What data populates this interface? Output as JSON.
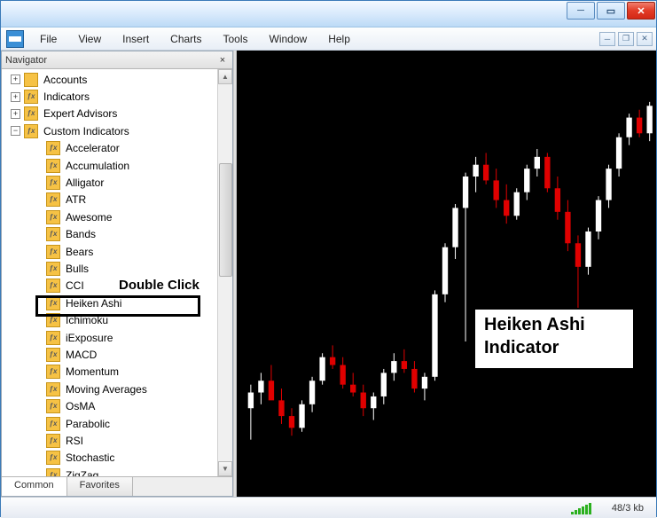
{
  "menu": {
    "items": [
      "File",
      "View",
      "Insert",
      "Charts",
      "Tools",
      "Window",
      "Help"
    ]
  },
  "navigator": {
    "title": "Navigator",
    "close_glyph": "×",
    "top": [
      {
        "label": "Accounts",
        "kind": "acc"
      },
      {
        "label": "Indicators",
        "kind": "fx"
      },
      {
        "label": "Expert Advisors",
        "kind": "fx"
      },
      {
        "label": "Custom Indicators",
        "kind": "fx",
        "expanded": true
      }
    ],
    "children": [
      "Accelerator",
      "Accumulation",
      "Alligator",
      "ATR",
      "Awesome",
      "Bands",
      "Bears",
      "Bulls",
      "CCI",
      "Heiken Ashi",
      "Ichimoku",
      "iExposure",
      "MACD",
      "Momentum",
      "Moving Averages",
      "OsMA",
      "Parabolic",
      "RSI",
      "Stochastic",
      "ZigZag"
    ],
    "highlight_label": "Double Click",
    "tabs": {
      "common": "Common",
      "favorites": "Favorites"
    }
  },
  "annotation": {
    "line1": "Heiken Ashi",
    "line2": "Indicator"
  },
  "status": {
    "net": "48/3 kb"
  },
  "chart_data": {
    "type": "candlestick",
    "note": "Heiken Ashi candles — approximate OHLC read from pixels on a price-axis-hidden chart. Values are relative (0..1) along visible y-range.",
    "candles": [
      {
        "o": 0.18,
        "h": 0.24,
        "l": 0.1,
        "c": 0.22,
        "dir": "up"
      },
      {
        "o": 0.22,
        "h": 0.27,
        "l": 0.19,
        "c": 0.25,
        "dir": "up"
      },
      {
        "o": 0.25,
        "h": 0.29,
        "l": 0.22,
        "c": 0.2,
        "dir": "down"
      },
      {
        "o": 0.2,
        "h": 0.23,
        "l": 0.14,
        "c": 0.16,
        "dir": "down"
      },
      {
        "o": 0.16,
        "h": 0.18,
        "l": 0.11,
        "c": 0.13,
        "dir": "down"
      },
      {
        "o": 0.13,
        "h": 0.2,
        "l": 0.12,
        "c": 0.19,
        "dir": "up"
      },
      {
        "o": 0.19,
        "h": 0.26,
        "l": 0.17,
        "c": 0.25,
        "dir": "up"
      },
      {
        "o": 0.25,
        "h": 0.32,
        "l": 0.24,
        "c": 0.31,
        "dir": "up"
      },
      {
        "o": 0.31,
        "h": 0.34,
        "l": 0.28,
        "c": 0.29,
        "dir": "down"
      },
      {
        "o": 0.29,
        "h": 0.31,
        "l": 0.23,
        "c": 0.24,
        "dir": "down"
      },
      {
        "o": 0.24,
        "h": 0.27,
        "l": 0.21,
        "c": 0.22,
        "dir": "down"
      },
      {
        "o": 0.22,
        "h": 0.24,
        "l": 0.16,
        "c": 0.18,
        "dir": "down"
      },
      {
        "o": 0.18,
        "h": 0.22,
        "l": 0.15,
        "c": 0.21,
        "dir": "up"
      },
      {
        "o": 0.21,
        "h": 0.28,
        "l": 0.19,
        "c": 0.27,
        "dir": "up"
      },
      {
        "o": 0.27,
        "h": 0.32,
        "l": 0.25,
        "c": 0.3,
        "dir": "up"
      },
      {
        "o": 0.3,
        "h": 0.33,
        "l": 0.27,
        "c": 0.28,
        "dir": "down"
      },
      {
        "o": 0.28,
        "h": 0.3,
        "l": 0.22,
        "c": 0.23,
        "dir": "down"
      },
      {
        "o": 0.23,
        "h": 0.27,
        "l": 0.2,
        "c": 0.26,
        "dir": "up"
      },
      {
        "o": 0.26,
        "h": 0.48,
        "l": 0.25,
        "c": 0.47,
        "dir": "up"
      },
      {
        "o": 0.47,
        "h": 0.6,
        "l": 0.45,
        "c": 0.59,
        "dir": "up"
      },
      {
        "o": 0.59,
        "h": 0.7,
        "l": 0.56,
        "c": 0.69,
        "dir": "up"
      },
      {
        "o": 0.69,
        "h": 0.78,
        "l": 0.35,
        "c": 0.77,
        "dir": "up"
      },
      {
        "o": 0.77,
        "h": 0.82,
        "l": 0.73,
        "c": 0.8,
        "dir": "up"
      },
      {
        "o": 0.8,
        "h": 0.83,
        "l": 0.75,
        "c": 0.76,
        "dir": "down"
      },
      {
        "o": 0.76,
        "h": 0.79,
        "l": 0.69,
        "c": 0.71,
        "dir": "down"
      },
      {
        "o": 0.71,
        "h": 0.75,
        "l": 0.65,
        "c": 0.67,
        "dir": "down"
      },
      {
        "o": 0.67,
        "h": 0.74,
        "l": 0.66,
        "c": 0.73,
        "dir": "up"
      },
      {
        "o": 0.73,
        "h": 0.8,
        "l": 0.71,
        "c": 0.79,
        "dir": "up"
      },
      {
        "o": 0.79,
        "h": 0.84,
        "l": 0.77,
        "c": 0.82,
        "dir": "up"
      },
      {
        "o": 0.82,
        "h": 0.83,
        "l": 0.73,
        "c": 0.74,
        "dir": "down"
      },
      {
        "o": 0.74,
        "h": 0.77,
        "l": 0.66,
        "c": 0.68,
        "dir": "down"
      },
      {
        "o": 0.68,
        "h": 0.71,
        "l": 0.58,
        "c": 0.6,
        "dir": "down"
      },
      {
        "o": 0.6,
        "h": 0.62,
        "l": 0.42,
        "c": 0.54,
        "dir": "down"
      },
      {
        "o": 0.54,
        "h": 0.64,
        "l": 0.52,
        "c": 0.63,
        "dir": "up"
      },
      {
        "o": 0.63,
        "h": 0.72,
        "l": 0.61,
        "c": 0.71,
        "dir": "up"
      },
      {
        "o": 0.71,
        "h": 0.8,
        "l": 0.69,
        "c": 0.79,
        "dir": "up"
      },
      {
        "o": 0.79,
        "h": 0.88,
        "l": 0.77,
        "c": 0.87,
        "dir": "up"
      },
      {
        "o": 0.87,
        "h": 0.93,
        "l": 0.85,
        "c": 0.92,
        "dir": "up"
      },
      {
        "o": 0.92,
        "h": 0.94,
        "l": 0.87,
        "c": 0.88,
        "dir": "down"
      },
      {
        "o": 0.88,
        "h": 0.96,
        "l": 0.86,
        "c": 0.95,
        "dir": "up"
      }
    ]
  }
}
